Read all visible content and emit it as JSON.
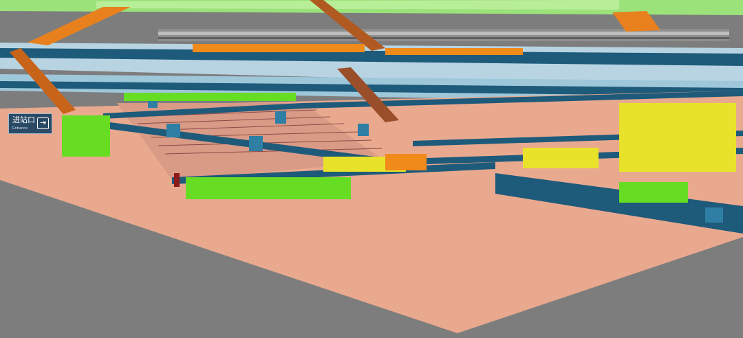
{
  "scene": {
    "palette": {
      "ground": "#7d7d7d",
      "concourse_floor": "#e9a98f",
      "barrier": "#1e5a7a",
      "barrier_top": "#2f7fa5",
      "glass": "#9fd0e6",
      "escalator": "#e8801e",
      "roof_green": "#8ee06a",
      "train": "#9a9a9a",
      "density_low": "#66dd22",
      "density_mid": "#e8e22a",
      "density_high": "#f08a1a",
      "density_peak": "#8b1a1a"
    }
  },
  "entrance_sign": {
    "label": "进站口",
    "sublabel": "Entrance",
    "icon": "enter-door-icon"
  }
}
